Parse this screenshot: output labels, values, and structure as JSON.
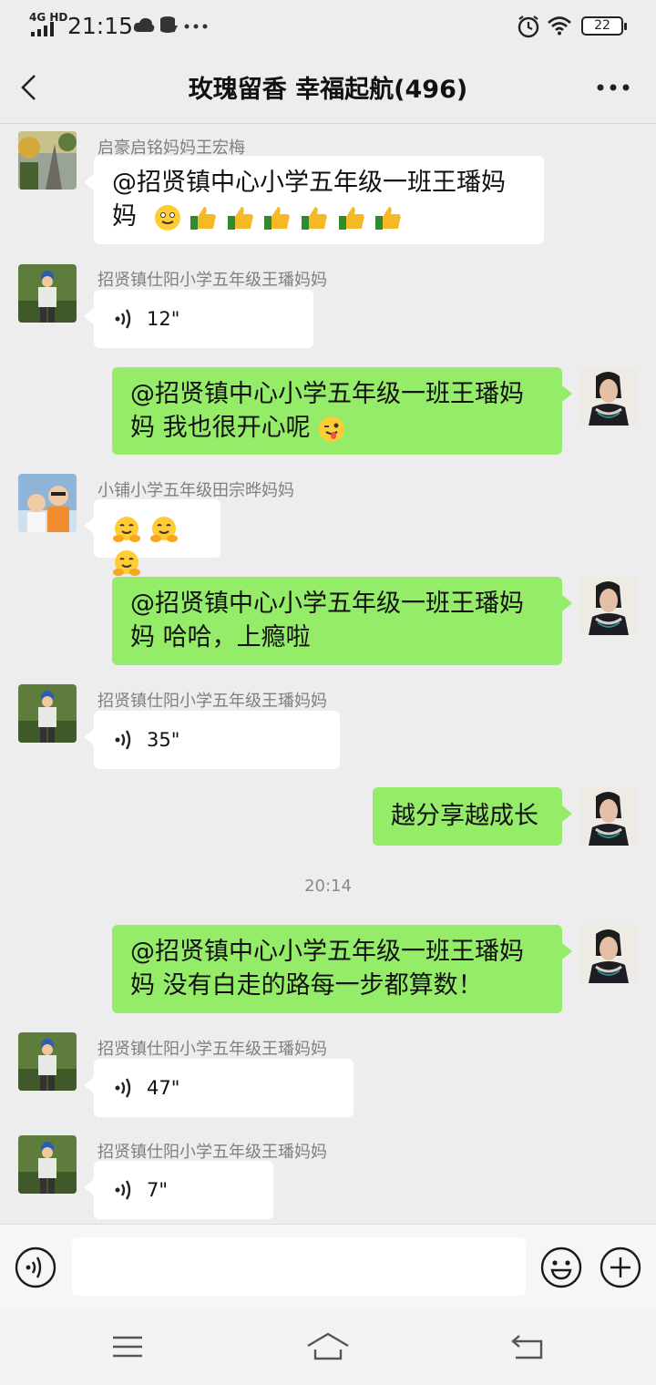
{
  "status_bar": {
    "network": "4G HD",
    "time": "21:15",
    "battery": "22"
  },
  "header": {
    "title": "玫瑰留香 幸福起航(496)"
  },
  "messages": [
    {
      "sender": "启豪启铭妈妈王宏梅",
      "text_line1": "@招贤镇中心小学五年级一班王璠妈",
      "text_line2": "妈"
    },
    {
      "sender": "招贤镇仕阳小学五年级王璠妈妈",
      "voice_duration": "12\""
    },
    {
      "text_line1": "@招贤镇中心小学五年级一班王璠妈",
      "text_line2": "妈  我也很开心呢"
    },
    {
      "sender": "小铺小学五年级田宗晔妈妈"
    },
    {
      "text_line1": "@招贤镇中心小学五年级一班王璠妈",
      "text_line2": "妈  哈哈，上瘾啦"
    },
    {
      "sender": "招贤镇仕阳小学五年级王璠妈妈",
      "voice_duration": "35\""
    },
    {
      "text": "越分享越成长"
    },
    {
      "timestamp": "20:14"
    },
    {
      "text_line1": "@招贤镇中心小学五年级一班王璠妈",
      "text_line2": "妈  没有白走的路每一步都算数！"
    },
    {
      "sender": "招贤镇仕阳小学五年级王璠妈妈",
      "voice_duration": "47\""
    },
    {
      "sender": "招贤镇仕阳小学五年级王璠妈妈",
      "voice_duration": "7\""
    }
  ],
  "input_bar": {
    "value": "",
    "icons": [
      "voice-mode-icon",
      "emoji-icon",
      "plus-icon"
    ]
  },
  "icons": {
    "back": "chevron-left-icon",
    "more": "more-dots-icon",
    "footer": [
      "menu-icon",
      "home-icon",
      "back-nav-icon"
    ]
  },
  "colors": {
    "background": "#ededed",
    "outgoing_bubble": "#95ec69",
    "incoming_bubble": "#ffffff",
    "sender_name": "#7f7f7f"
  }
}
